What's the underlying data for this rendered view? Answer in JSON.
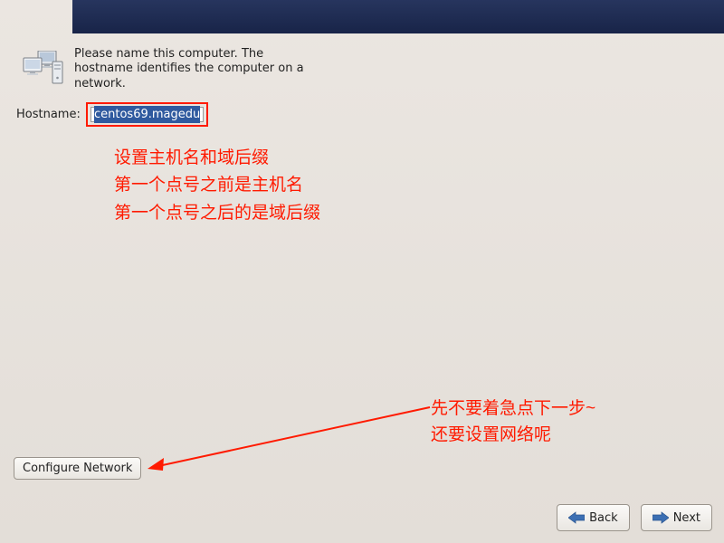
{
  "instruction": "Please name this computer.  The hostname identifies the computer on a network.",
  "hostname": {
    "label": "Hostname:",
    "value": "centos69.magedu"
  },
  "annotations": {
    "hostname_note_line1": "设置主机名和域后缀",
    "hostname_note_line2": "第一个点号之前是主机名",
    "hostname_note_line3": "第一个点号之后的是域后缀",
    "next_note_line1": "先不要着急点下一步~",
    "next_note_line2": "还要设置网络呢"
  },
  "buttons": {
    "configure_network": "Configure Network",
    "back": "Back",
    "next": "Next"
  }
}
